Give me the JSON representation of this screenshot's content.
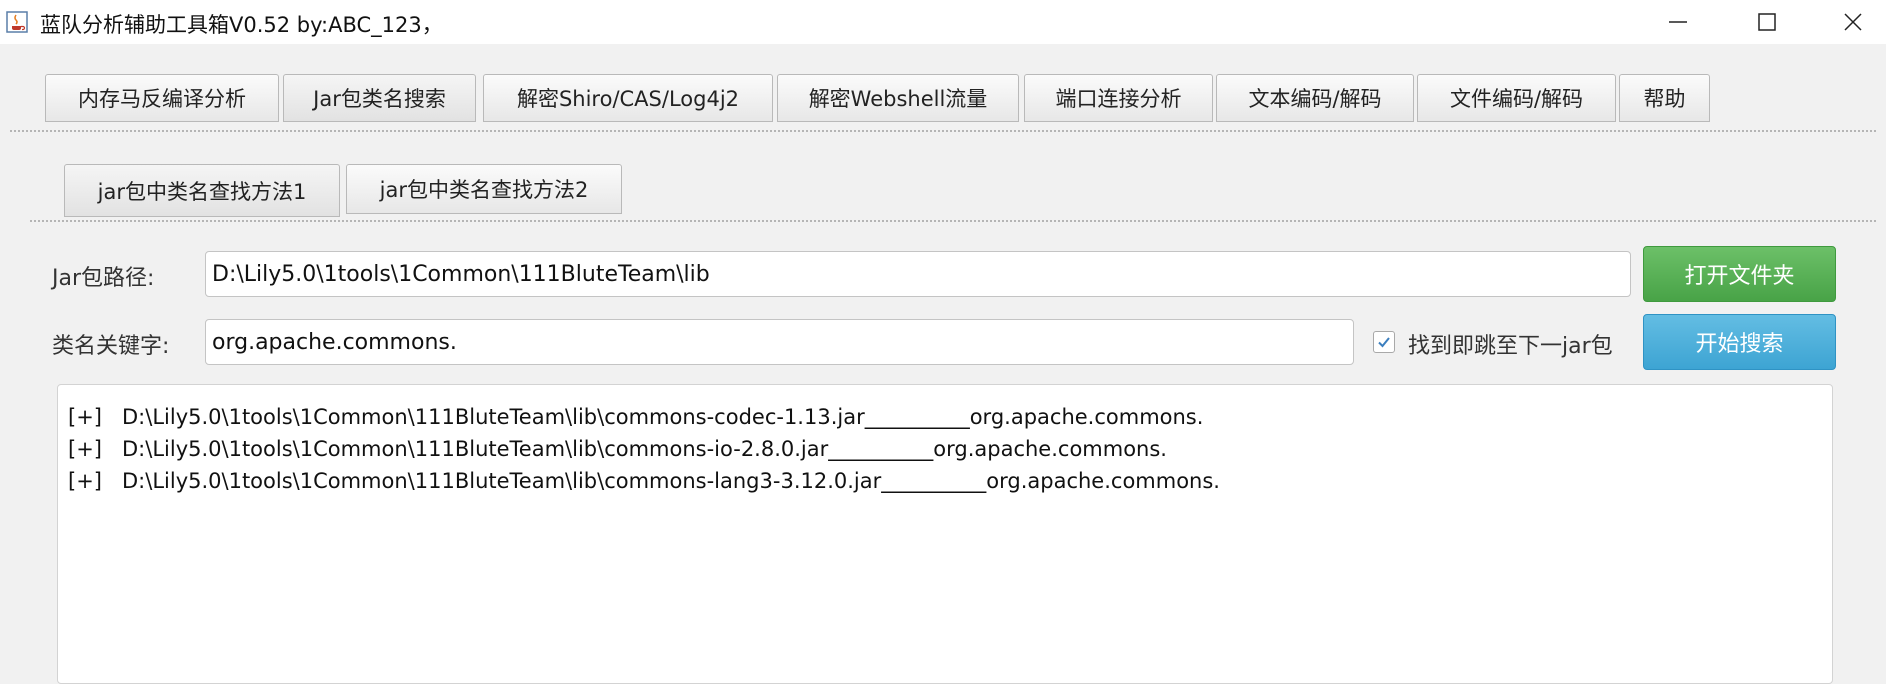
{
  "window": {
    "title": "蓝队分析辅助工具箱V0.52 by:ABC_123，",
    "icon": "java-icon"
  },
  "main_tabs": [
    {
      "label": "内存马反编译分析"
    },
    {
      "label": "Jar包类名搜索",
      "selected": true
    },
    {
      "label": "解密Shiro/CAS/Log4j2"
    },
    {
      "label": "解密Webshell流量"
    },
    {
      "label": "端口连接分析"
    },
    {
      "label": "文本编码/解码"
    },
    {
      "label": "文件编码/解码"
    },
    {
      "label": "帮助"
    }
  ],
  "sub_tabs": [
    {
      "label": "jar包中类名查找方法1",
      "selected": true
    },
    {
      "label": "jar包中类名查找方法2"
    }
  ],
  "form": {
    "jar_path_label": "Jar包路径:",
    "jar_path_value": "D:\\Lily5.0\\1tools\\1Common\\111BluteTeam\\lib",
    "open_folder_button": "打开文件夹",
    "keyword_label": "类名关键字:",
    "keyword_value": "org.apache.commons.",
    "jump_checkbox_label": "找到即跳至下一jar包",
    "jump_checkbox_checked": true,
    "search_button": "开始搜索"
  },
  "results": [
    {
      "prefix": "[+]",
      "path": "D:\\Lily5.0\\1tools\\1Common\\111BluteTeam\\lib\\commons-codec-1.13.jar__________org.apache.commons."
    },
    {
      "prefix": "[+]",
      "path": "D:\\Lily5.0\\1tools\\1Common\\111BluteTeam\\lib\\commons-io-2.8.0.jar__________org.apache.commons."
    },
    {
      "prefix": "[+]",
      "path": "D:\\Lily5.0\\1tools\\1Common\\111BluteTeam\\lib\\commons-lang3-3.12.0.jar__________org.apache.commons."
    }
  ],
  "colors": {
    "open_button": "#4ba84a",
    "search_button": "#3fa7d6"
  }
}
